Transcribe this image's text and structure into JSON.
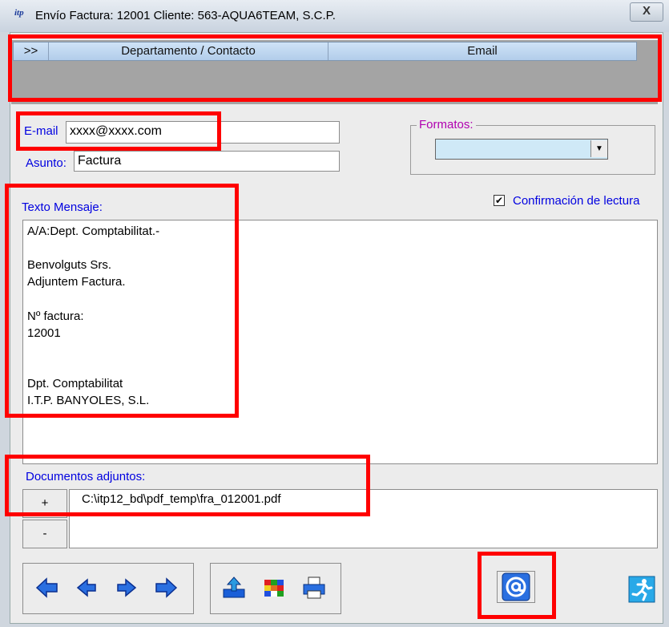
{
  "window": {
    "title": "Envío Factura: 12001 Cliente: 563-AQUA6TEAM, S.C.P.",
    "app_icon": "itp-app-icon",
    "close_label": "X"
  },
  "grid": {
    "columns": [
      ">>",
      "Departamento / Contacto",
      "Email"
    ]
  },
  "form": {
    "email_label": "E-mail",
    "email_value": "xxxx@xxxx.com",
    "subject_label": "Asunto:",
    "subject_value": "Factura",
    "formats_label": "Formatos:",
    "formats_value": "",
    "message_label": "Texto Mensaje:",
    "read_receipt_label": "Confirmación de lectura",
    "read_receipt_checked": true,
    "message_lines": [
      "A/A:Dept. Comptabilitat.-",
      "",
      "Benvolguts Srs.",
      "Adjuntem Factura.",
      "",
      "Nº factura:",
      "12001",
      "",
      "",
      "Dpt. Comptabilitat",
      "I.T.P. BANYOLES, S.L."
    ],
    "attachments_label": "Documentos adjuntos:",
    "add_attachment_label": "+",
    "remove_attachment_label": "-",
    "attachments": [
      "C:\\itp12_bd\\pdf_temp\\fra_012001.pdf"
    ]
  },
  "toolbar": {
    "nav_icons": [
      "first-arrow-icon",
      "prev-arrow-icon",
      "next-arrow-icon",
      "last-arrow-icon"
    ],
    "tool_icons": [
      "export-icon",
      "cube-icon",
      "printer-icon"
    ],
    "send_icon": "email-at-icon",
    "exit_icon": "running-man-exit-icon"
  },
  "colors": {
    "highlight": "#ff0000",
    "label_blue": "#0000e0",
    "formats_purple": "#b000b0",
    "grid_header": "#b2cdea",
    "select_bg": "#cfe9f7"
  }
}
